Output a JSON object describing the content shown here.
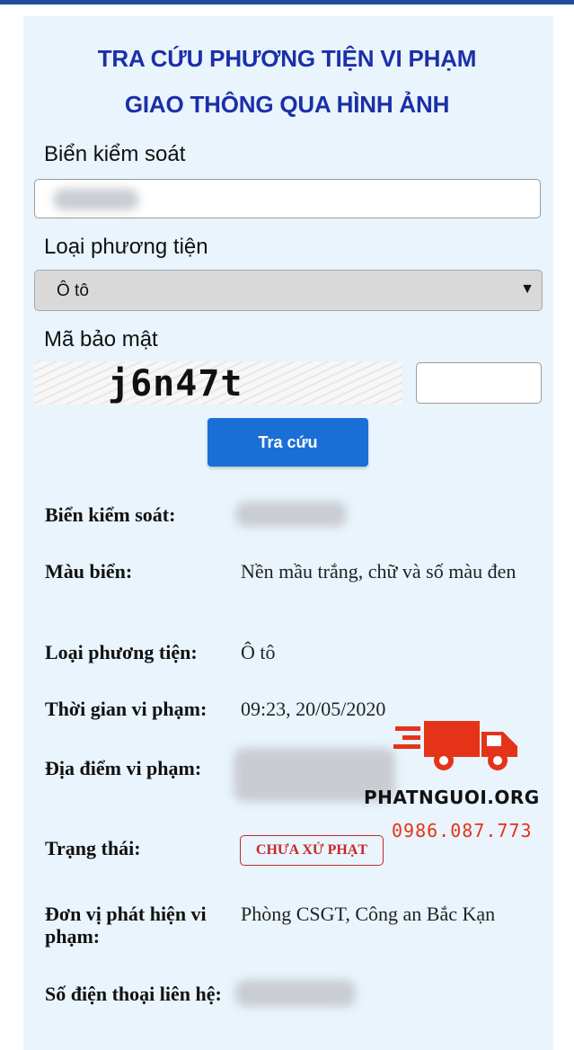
{
  "header": {
    "title_line1": "TRA CỨU PHƯƠNG TIỆN VI PHẠM",
    "title_line2": "GIAO THÔNG QUA HÌNH ẢNH"
  },
  "form": {
    "plate_label": "Biển kiểm soát",
    "vehicle_type_label": "Loại phương tiện",
    "vehicle_type_value": "Ô tô",
    "captcha_label": "Mã bảo mật",
    "captcha_text": "j6n47t",
    "submit_label": "Tra cứu"
  },
  "result": {
    "plate_key": "Biển kiểm soát:",
    "plate_color_key": "Màu biển:",
    "plate_color_value": "Nền mầu trắng, chữ và số màu đen",
    "vehicle_type_key": "Loại phương tiện:",
    "vehicle_type_value": "Ô tô",
    "time_key": "Thời gian vi phạm:",
    "time_value": "09:23, 20/05/2020",
    "location_key": "Địa điểm vi phạm:",
    "status_key": "Trạng thái:",
    "status_value": "CHƯA XỬ PHẠT",
    "unit_key": "Đơn vị phát hiện vi phạm:",
    "unit_value": "Phòng CSGT, Công an Bắc Kạn",
    "phone_key": "Số điện thoại liên hệ:"
  },
  "watermark": {
    "brand": "PHATNGUOI.ORG",
    "phone": "0986.087.773"
  },
  "colors": {
    "panel_bg": "#e9f4fc",
    "title": "#1c2fa8",
    "button": "#1a6fd6",
    "status": "#c62828",
    "watermark_red": "#e53319"
  }
}
